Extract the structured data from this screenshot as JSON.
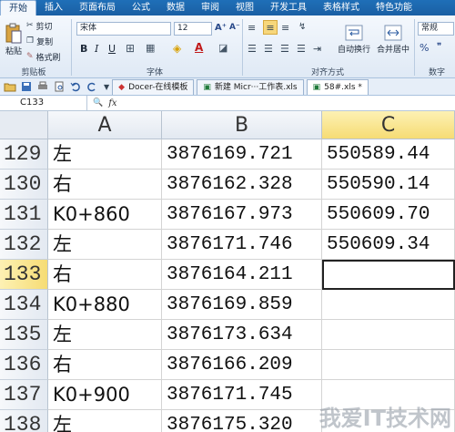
{
  "menu_tabs": [
    "开始",
    "插入",
    "页面布局",
    "公式",
    "数据",
    "审阅",
    "视图",
    "开发工具",
    "表格样式",
    "特色功能"
  ],
  "ribbon": {
    "paste_label": "粘贴",
    "cut_label": "剪切",
    "copy_label": "复制",
    "format_painter_label": "格式刷",
    "clipboard_group": "剪贴板",
    "font_name": "宋体",
    "font_size": "12",
    "font_group": "字体",
    "align_group": "对齐方式",
    "wrap_label": "自动换行",
    "merge_label": "合并居中",
    "number_group": "数字",
    "regular_label": "常规",
    "percent_symbol": "%"
  },
  "doc_tabs": [
    "Docer-在线模板",
    "新建 Micr···工作表.xls",
    "58#.xls *"
  ],
  "formula_bar": {
    "name_box": "C133",
    "fx": "fx",
    "content": ""
  },
  "columns": [
    "A",
    "B",
    "C"
  ],
  "rows": [
    {
      "num": "129",
      "a": "左",
      "b": "3876169.721",
      "c": "550589.44"
    },
    {
      "num": "130",
      "a": "右",
      "b": "3876162.328",
      "c": "550590.14"
    },
    {
      "num": "131",
      "a": "K0+860",
      "b": "3876167.973",
      "c": "550609.70"
    },
    {
      "num": "132",
      "a": "左",
      "b": "3876171.746",
      "c": "550609.34"
    },
    {
      "num": "133",
      "a": "右",
      "b": "3876164.211",
      "c": ""
    },
    {
      "num": "134",
      "a": "K0+880",
      "b": "3876169.859",
      "c": ""
    },
    {
      "num": "135",
      "a": "左",
      "b": "3876173.634",
      "c": ""
    },
    {
      "num": "136",
      "a": "右",
      "b": "3876166.209",
      "c": ""
    },
    {
      "num": "137",
      "a": "K0+900",
      "b": "3876171.745",
      "c": ""
    },
    {
      "num": "138",
      "a": "左",
      "b": "3876175.320",
      "c": ""
    }
  ],
  "watermark": "我爱IT技术网"
}
